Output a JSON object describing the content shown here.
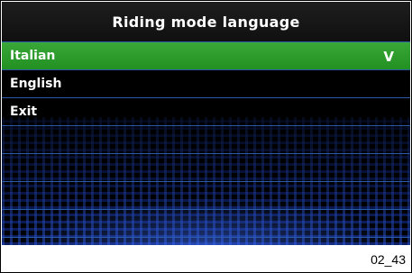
{
  "title": "Riding mode language",
  "menu": {
    "items": [
      {
        "label": "Italian",
        "selected": true,
        "check": "V"
      },
      {
        "label": "English",
        "selected": false
      },
      {
        "label": "Exit",
        "selected": false
      }
    ]
  },
  "figure_code": "02_43",
  "colors": {
    "selected_background": "#2e9a2c",
    "screen_background": "#000000",
    "divider": "#2a5aa8",
    "text": "#ffffff"
  }
}
